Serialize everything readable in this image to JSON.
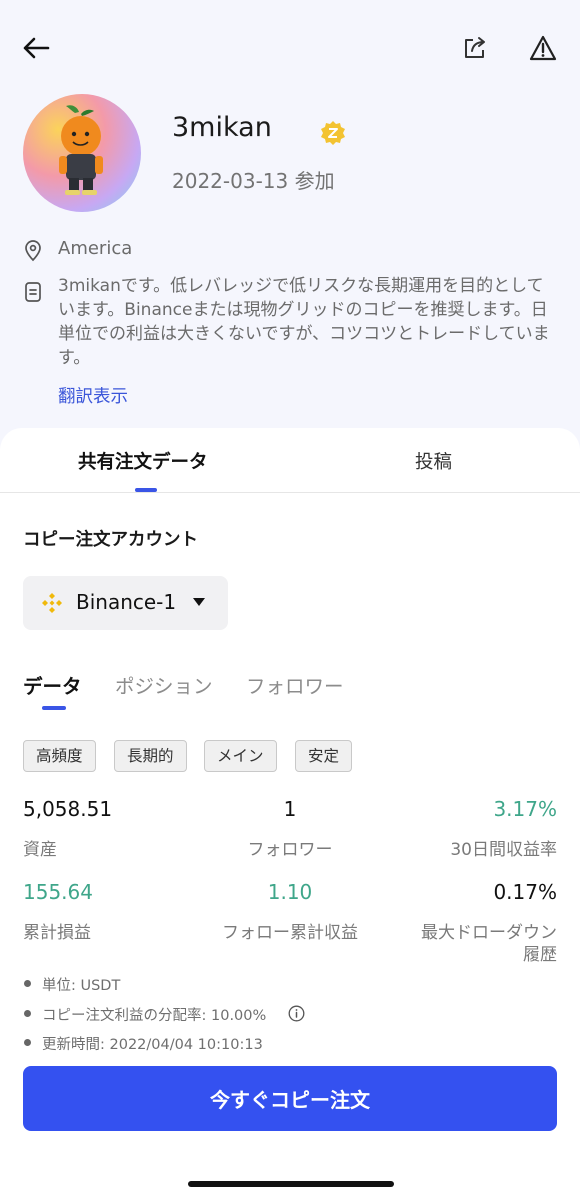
{
  "header": {
    "back_icon": "arrow-left-icon",
    "share_icon": "share-icon",
    "report_icon": "warning-triangle-icon"
  },
  "profile": {
    "avatar_icon": "orange-character-avatar",
    "username": "3mikan",
    "badge_icon": "verified-badge-icon",
    "joined": "2022-03-13 参加",
    "location_icon": "location-pin-icon",
    "location": "America",
    "bio_icon": "document-icon",
    "bio": "3mikanです。低レバレッジで低リスクな長期運用を目的としています。Binanceまたは現物グリッドのコピーを推奨します。日単位での利益は大きくないですが、コツコツとトレードしています。",
    "translate": "翻訳表示"
  },
  "tabs": {
    "shared_orders": "共有注文データ",
    "posts": "投稿",
    "active": "共有注文データ"
  },
  "copy_account": {
    "title": "コピー注文アカウント",
    "selected": "Binance-1",
    "exchange_icon": "binance-icon"
  },
  "subtabs": {
    "data": "データ",
    "positions": "ポジション",
    "followers": "フォロワー",
    "active": "データ"
  },
  "tags": [
    "高頻度",
    "長期的",
    "メイン",
    "安定"
  ],
  "metrics": {
    "assets_value": "5,058.51",
    "assets_label": "資産",
    "followers_value": "1",
    "followers_label": "フォロワー",
    "roi30_value": "3.17%",
    "roi30_label": "30日間収益率",
    "cum_pnl_value": "155.64",
    "cum_pnl_label": "累計損益",
    "follow_pnl_value": "1.10",
    "follow_pnl_label": "フォロー累計収益",
    "mdd_value": "0.17%",
    "mdd_label_1": "最大ドローダウン",
    "mdd_label_2": "履歴"
  },
  "footnotes": {
    "unit": "単位: USDT",
    "profit_share": "コピー注文利益の分配率: 10.00%",
    "updated": "更新時間: 2022/04/04 10:10:13",
    "info_icon": "info-circle-icon"
  },
  "cta": "今すぐコピー注文",
  "colors": {
    "accent": "#3451f0",
    "positive": "#3fa68a",
    "link": "#3a55d9"
  }
}
